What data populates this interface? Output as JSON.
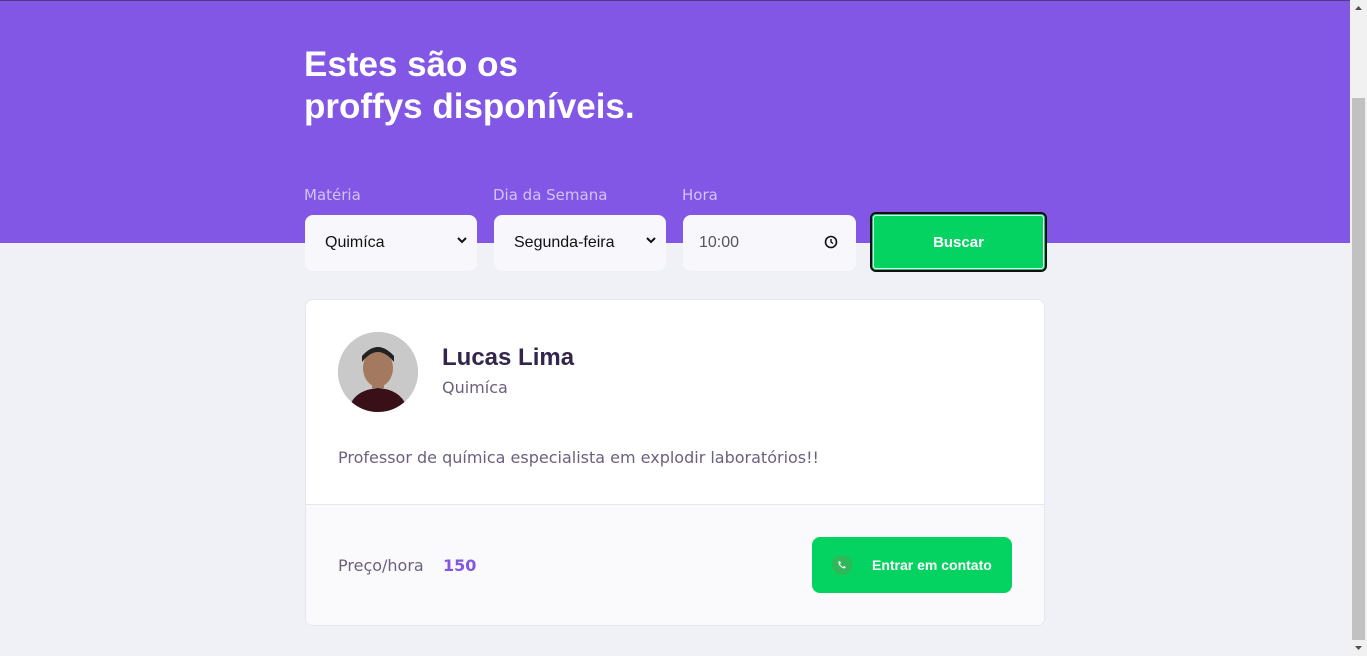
{
  "header": {
    "title_line1": "Estes são os",
    "title_line2": "proffys disponíveis."
  },
  "filters": {
    "subject_label": "Matéria",
    "subject_value": "Quimíca",
    "weekday_label": "Dia da Semana",
    "weekday_value": "Segunda-feira",
    "time_label": "Hora",
    "time_value": "10:00",
    "search_label": "Buscar"
  },
  "teacher": {
    "name": "Lucas Lima",
    "subject": "Quimíca",
    "bio": "Professor de química especialista em explodir laboratórios!!",
    "price_label": "Preço/hora",
    "price_value": "150",
    "contact_label": "Entrar em contato"
  },
  "colors": {
    "primary": "#8257E5",
    "secondary": "#04D361",
    "background": "#F0F0F7"
  }
}
